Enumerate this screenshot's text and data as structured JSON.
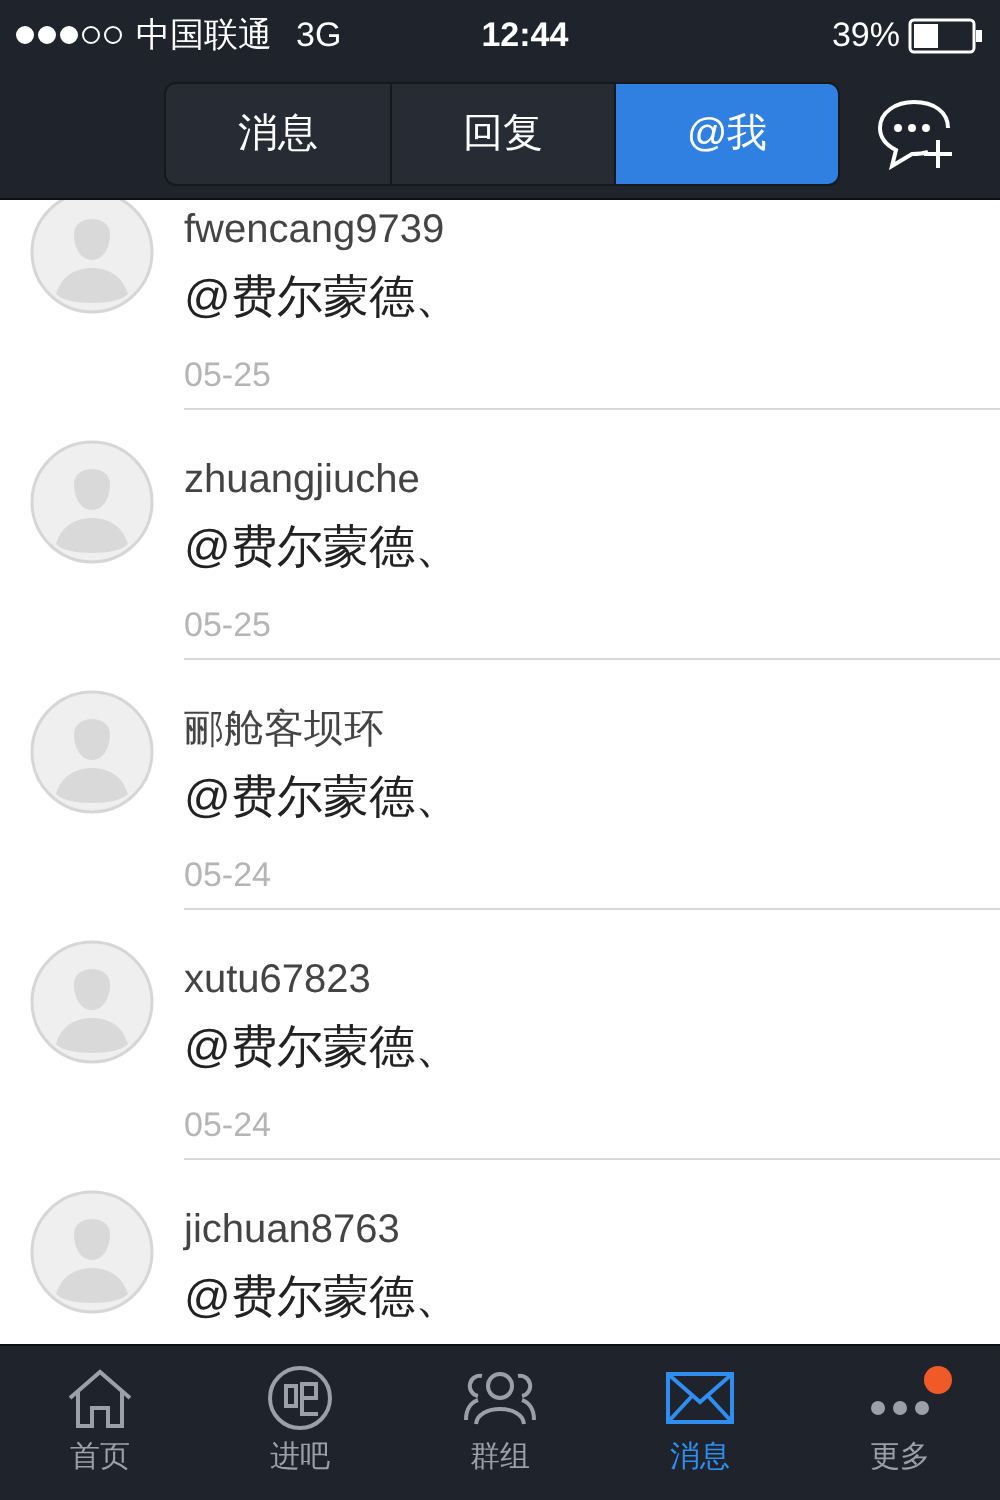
{
  "status_bar": {
    "carrier": "中国联通",
    "network": "3G",
    "time": "12:44",
    "battery": "39%"
  },
  "tabs": [
    {
      "label": "消息",
      "selected": false
    },
    {
      "label": "回复",
      "selected": false
    },
    {
      "label": "@我",
      "selected": true
    }
  ],
  "mentions": [
    {
      "user": "fwencang9739",
      "text": "@费尔蒙德、",
      "date": "05-25"
    },
    {
      "user": "zhuangjiuche",
      "text": "@费尔蒙德、",
      "date": "05-25"
    },
    {
      "user": "郦舱客坝环",
      "text": "@费尔蒙德、",
      "date": "05-24"
    },
    {
      "user": "xutu67823",
      "text": "@费尔蒙德、",
      "date": "05-24"
    },
    {
      "user": "jichuan8763",
      "text": "@费尔蒙德、"
    }
  ],
  "tab_bar": [
    {
      "kind": "home",
      "label": "首页",
      "selected": false,
      "badge": false
    },
    {
      "kind": "ba",
      "label": "进吧",
      "selected": false,
      "badge": false
    },
    {
      "kind": "group",
      "label": "群组",
      "selected": false,
      "badge": false
    },
    {
      "kind": "mail",
      "label": "消息",
      "selected": true,
      "badge": false
    },
    {
      "kind": "more",
      "label": "更多",
      "selected": false,
      "badge": true
    }
  ]
}
